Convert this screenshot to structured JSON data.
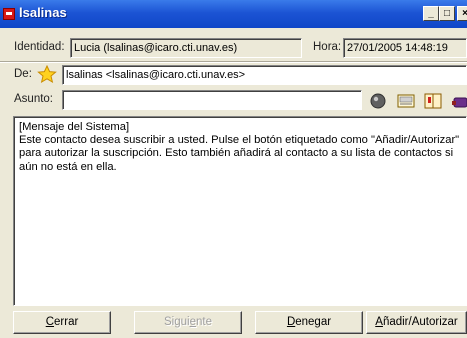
{
  "window": {
    "title": "lsalinas",
    "controls": {
      "minimize": "_",
      "maximize": "□",
      "close": "×"
    }
  },
  "identity": {
    "label": "Identidad:",
    "value": "Lucia (lsalinas@icaro.cti.unav.es)"
  },
  "time": {
    "label": "Hora:",
    "value": "27/01/2005 14:48:19"
  },
  "from": {
    "label": "De:",
    "value": "lsalinas <lsalinas@icaro.cti.unav.es>",
    "icon": "star-icon"
  },
  "subject": {
    "label": "Asunto:",
    "value": ""
  },
  "toolbar": {
    "icons": [
      "emoticon-icon",
      "id-card-icon",
      "address-book-icon",
      "extra-tool-icon"
    ]
  },
  "message": {
    "header": "[Mensaje del Sistema]",
    "body": "Este contacto desea suscribir a usted. Pulse el botón etiquetado como \"Añadir/Autorizar\" para autorizar la suscripción. Esto también añadirá al contacto a su lista de contactos si aún no está en ella."
  },
  "buttons": {
    "close": {
      "first": "C",
      "rest": "errar"
    },
    "next": {
      "before": "Sigui",
      "accel": "e",
      "after": "nte"
    },
    "deny": {
      "first": "D",
      "rest": "enegar"
    },
    "add": {
      "first": "A",
      "rest": "ñadir/Autorizar"
    }
  },
  "colors": {
    "titlebar": "#1c54d4",
    "face": "#ece9d8",
    "star": "#ffcc00"
  }
}
